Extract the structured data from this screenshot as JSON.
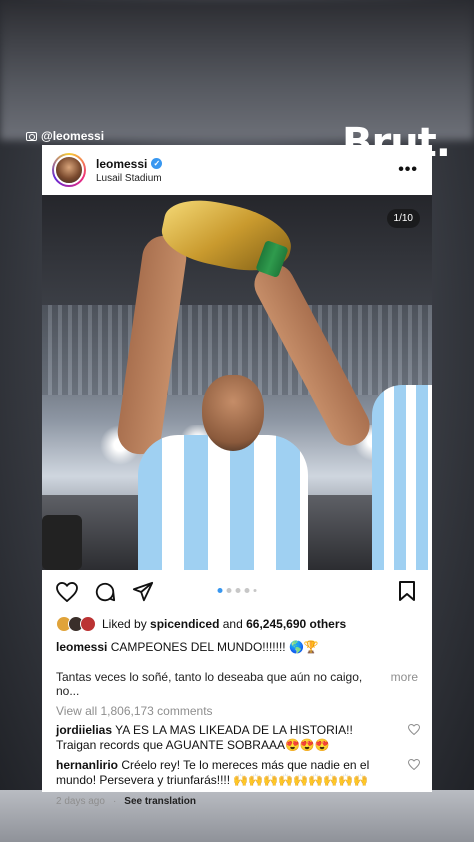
{
  "source": {
    "handle": "@leomessi",
    "brand": "Brut."
  },
  "post": {
    "username": "leomessi",
    "location": "Lusail Stadium",
    "image_counter": "1/10",
    "carousel": {
      "total_dots": 5,
      "active_index": 0
    },
    "likes": {
      "prefix": "Liked by",
      "liker": "spicendiced",
      "and": "and",
      "count": "66,245,690 others"
    },
    "caption": {
      "username": "leomessi",
      "text": "CAMPEONES DEL MUNDO!!!!!!! 🌎🏆"
    },
    "caption_second": "Tantas veces lo soñé, tanto lo deseaba que aún no caigo, no...",
    "more_label": "more",
    "view_comments": "View all 1,806,173 comments",
    "comments": [
      {
        "username": "jordiielias",
        "text": "YA ES LA MAS LIKEADA DE LA HISTORIA!! Traigan records que AGUANTE SOBRAAA😍😍😍"
      },
      {
        "username": "hernanlirio",
        "text": "Créelo rey! Te lo mereces más que nadie en el mundo! Persevera y triunfarás!!!! 🙌🙌🙌🙌🙌🙌🙌🙌🙌"
      }
    ],
    "timestamp": "2 days ago",
    "translate_label": "See translation"
  },
  "colors": {
    "accent_blue": "#3897f0",
    "argentina_blue": "#9fd0f2",
    "trophy_gold": "#c99a2e"
  },
  "icons": [
    "camera-icon",
    "verified-icon",
    "more-icon",
    "heart-icon",
    "comment-icon",
    "share-icon",
    "save-icon"
  ]
}
